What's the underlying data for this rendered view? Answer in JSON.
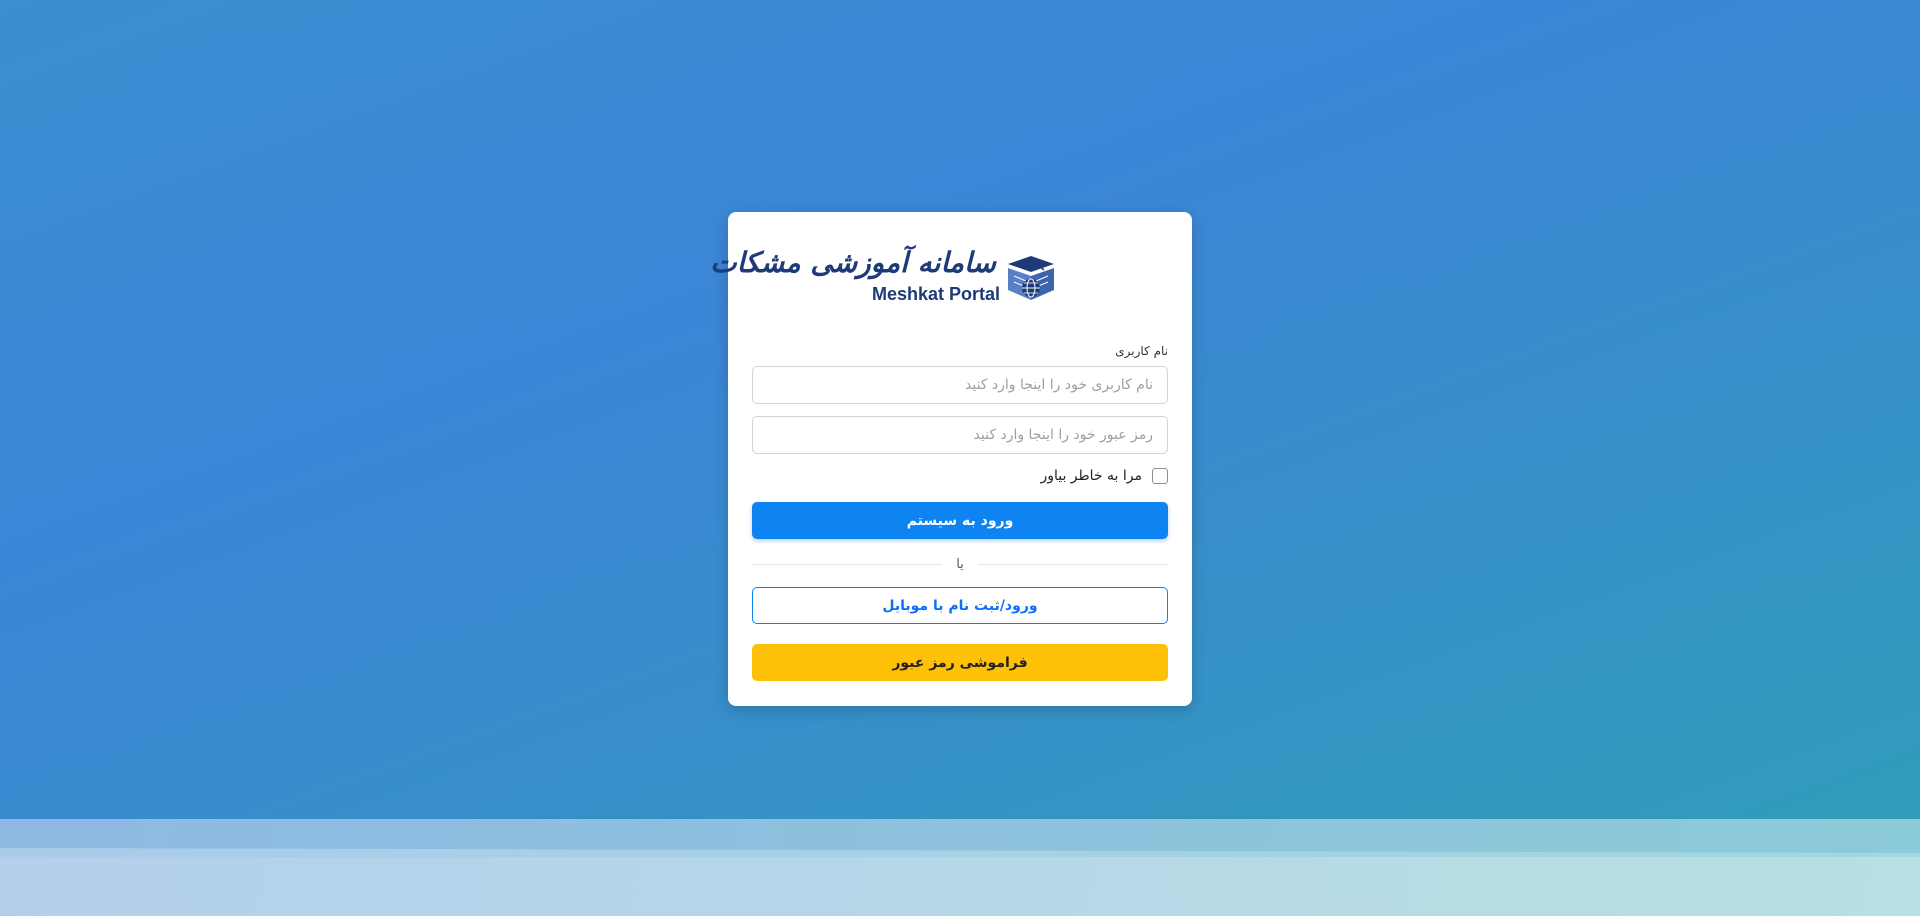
{
  "logo": {
    "persian_text": "سامانه آموزشی مشکات",
    "english_text": "Meshkat Portal"
  },
  "form": {
    "username_label": "نام کاربری",
    "username_placeholder": "نام کاربری خود را اینجا وارد کنید",
    "password_placeholder": "رمز عبور خود را اینجا وارد کنید",
    "remember_label": "مرا به خاطر بیاور",
    "login_button": "ورود به سیستم",
    "or_text": "یا",
    "mobile_button": "ورود/ثبت نام با موبایل",
    "forgot_button": "فراموشی رمز عبور"
  },
  "colors": {
    "primary": "#0d84f2",
    "warning": "#ffc107",
    "logo_blue": "#1e3a78"
  },
  "icons": {
    "logo": "graduation-cap-globe-icon",
    "remember": "checkbox-icon"
  }
}
